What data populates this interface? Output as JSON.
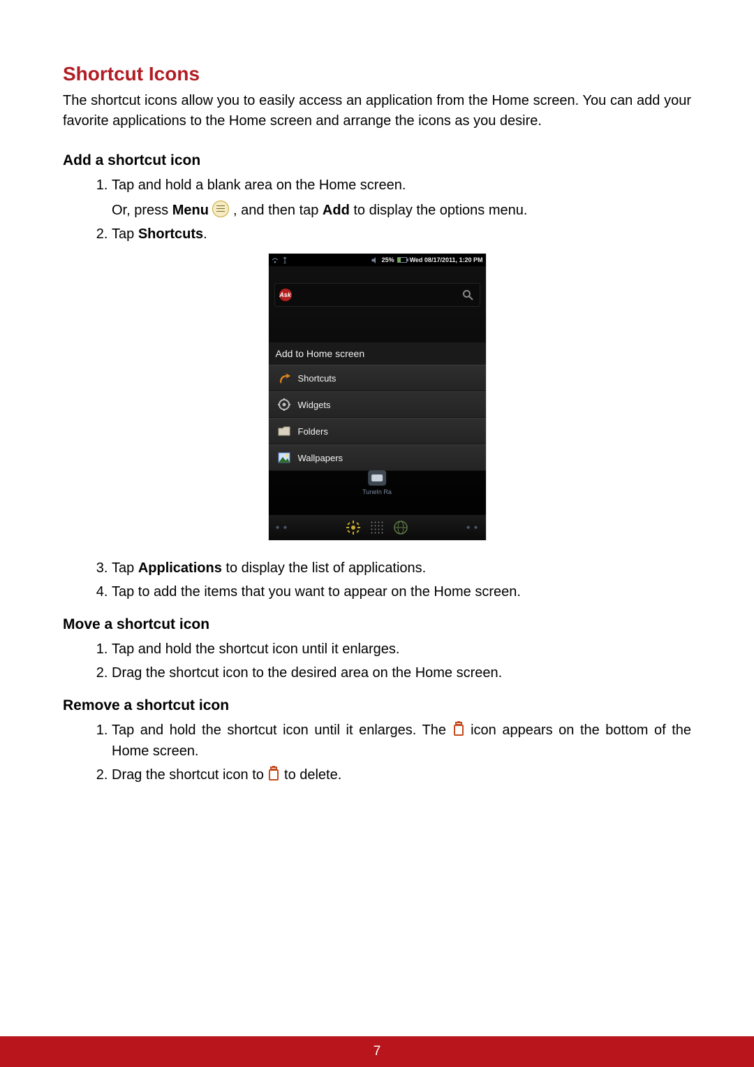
{
  "page_number": "7",
  "heading": "Shortcut Icons",
  "intro": "The shortcut icons allow you to easily access an application from the Home screen. You can add your favorite applications to the Home screen and arrange the icons as you desire.",
  "add": {
    "heading": "Add a shortcut icon",
    "step1": "Tap and hold a blank area on the Home screen.",
    "step1b_prefix": "Or, press ",
    "step1b_menu_bold": "Menu",
    "step1b_mid": " , and then tap ",
    "step1b_add_bold": "Add",
    "step1b_suffix": " to display the options menu.",
    "step2_prefix": "Tap ",
    "step2_bold": "Shortcuts",
    "step2_suffix": ".",
    "step3_prefix": "Tap ",
    "step3_bold": "Applications",
    "step3_suffix": " to display the list of applications.",
    "step4": "Tap to add the items that you want to appear on the Home screen."
  },
  "move": {
    "heading": "Move a shortcut icon",
    "step1": "Tap and hold the shortcut icon until it enlarges.",
    "step2": "Drag the shortcut icon to the desired area on the Home screen."
  },
  "remove": {
    "heading": "Remove a shortcut icon",
    "step1_prefix": "Tap and hold the shortcut icon until it enlarges. The ",
    "step1_suffix": " icon appears on the bottom of the Home screen.",
    "step2_prefix": "Drag the shortcut icon to ",
    "step2_suffix": " to delete."
  },
  "screenshot": {
    "status": {
      "battery_pct": "25%",
      "datetime": "Wed 08/17/2011, 1:20 PM"
    },
    "ask_badge": "Ask",
    "dialog_title": "Add to Home screen",
    "items": {
      "shortcuts": "Shortcuts",
      "widgets": "Widgets",
      "folders": "Folders",
      "wallpapers": "Wallpapers"
    },
    "mid_app_label": "TuneIn Ra"
  }
}
